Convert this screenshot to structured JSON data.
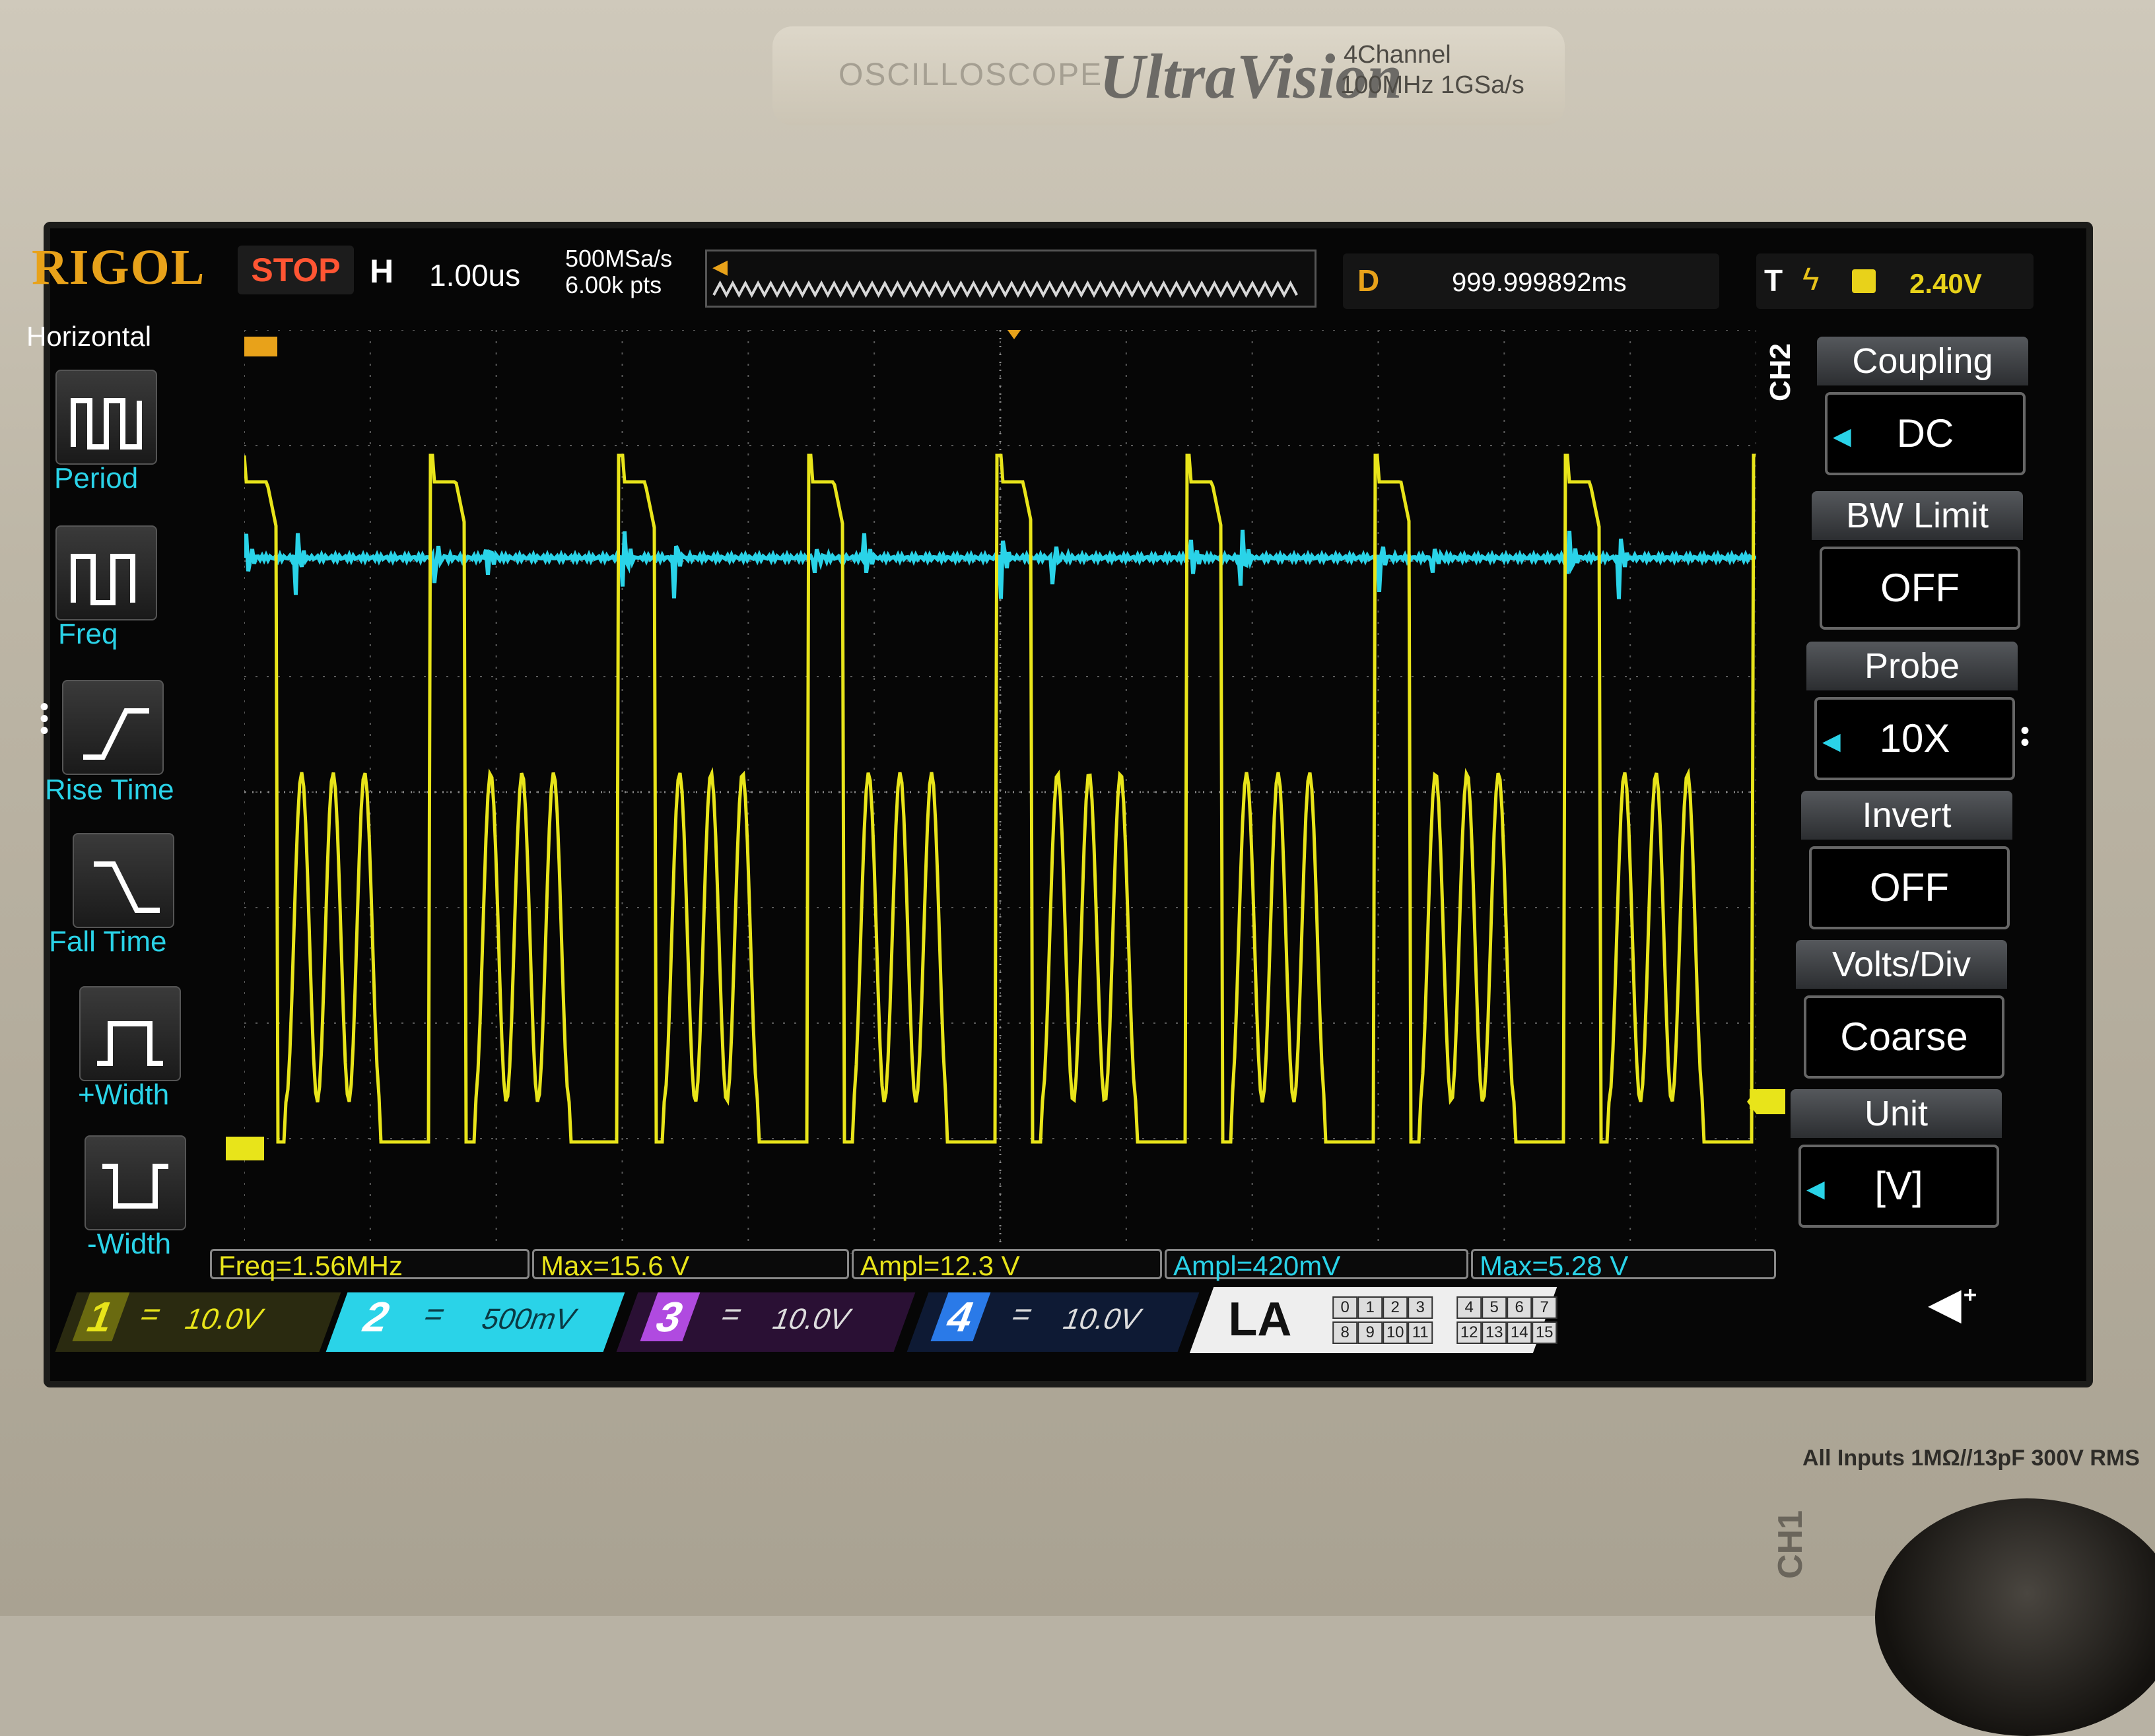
{
  "device": {
    "brand_line": "OSCILLOSCOPE",
    "model": "UltraVision",
    "channels": "4Channel",
    "spec": "100MHz  1GSa/s",
    "inputs_label": "All Inputs 1MΩ//13pF 300V RMS",
    "ch1_label": "CH1"
  },
  "status": {
    "logo": "RIGOL",
    "run_state": "STOP",
    "h_label": "H",
    "timebase": "1.00us",
    "sample_rate": "500MSa/s",
    "memory_depth": "6.00k pts",
    "delay_label": "D",
    "delay": "999.999892ms",
    "trigger_label": "T",
    "trigger_level": "2.40V",
    "trigger_color": "#e8d21a"
  },
  "left_menu": {
    "title": "Horizontal",
    "items": [
      {
        "label": "Period",
        "icon": "period-icon"
      },
      {
        "label": "Freq",
        "icon": "freq-icon"
      },
      {
        "label": "Rise Time",
        "icon": "rise-time-icon"
      },
      {
        "label": "Fall Time",
        "icon": "fall-time-icon"
      },
      {
        "label": "+Width",
        "icon": "pos-width-icon"
      },
      {
        "label": "-Width",
        "icon": "neg-width-icon"
      }
    ]
  },
  "right_menu": {
    "channel": "CH2",
    "groups": [
      {
        "title": "Coupling",
        "value": "DC",
        "arrow": true
      },
      {
        "title": "BW Limit",
        "value": "OFF",
        "arrow": false
      },
      {
        "title": "Probe",
        "value": "10X",
        "arrow": true
      },
      {
        "title": "Invert",
        "value": "OFF",
        "arrow": false
      },
      {
        "title": "Volts/Div",
        "value": "Coarse",
        "arrow": false
      },
      {
        "title": "Unit",
        "value": "[V]",
        "arrow": true
      }
    ]
  },
  "measurements": [
    {
      "text": "Freq=1.56MHz",
      "channel": 1
    },
    {
      "text": "Max=15.6 V",
      "channel": 1
    },
    {
      "text": "Ampl=12.3 V",
      "channel": 1
    },
    {
      "text": "Ampl=420mV",
      "channel": 2
    },
    {
      "text": "Max=5.28 V",
      "channel": 2
    }
  ],
  "channels": [
    {
      "num": "1",
      "coupling": "=",
      "scale": "10.0V",
      "color": "#e8e41a"
    },
    {
      "num": "2",
      "coupling": "=",
      "scale": "500mV",
      "color": "#2ad3e8"
    },
    {
      "num": "3",
      "coupling": "=",
      "scale": "10.0V",
      "color": "#b04ae0"
    },
    {
      "num": "4",
      "coupling": "=",
      "scale": "10.0V",
      "color": "#2a7ae8"
    }
  ],
  "logic_analyzer": {
    "label": "LA",
    "bits": [
      "0",
      "1",
      "2",
      "3",
      "4",
      "5",
      "6",
      "7",
      "8",
      "9",
      "10",
      "11",
      "12",
      "13",
      "14",
      "15"
    ]
  },
  "colors": {
    "ch1": "#e8e41a",
    "ch2": "#2ad3e8",
    "accent": "#e8a21a",
    "grid": "#5a5a5a"
  }
}
